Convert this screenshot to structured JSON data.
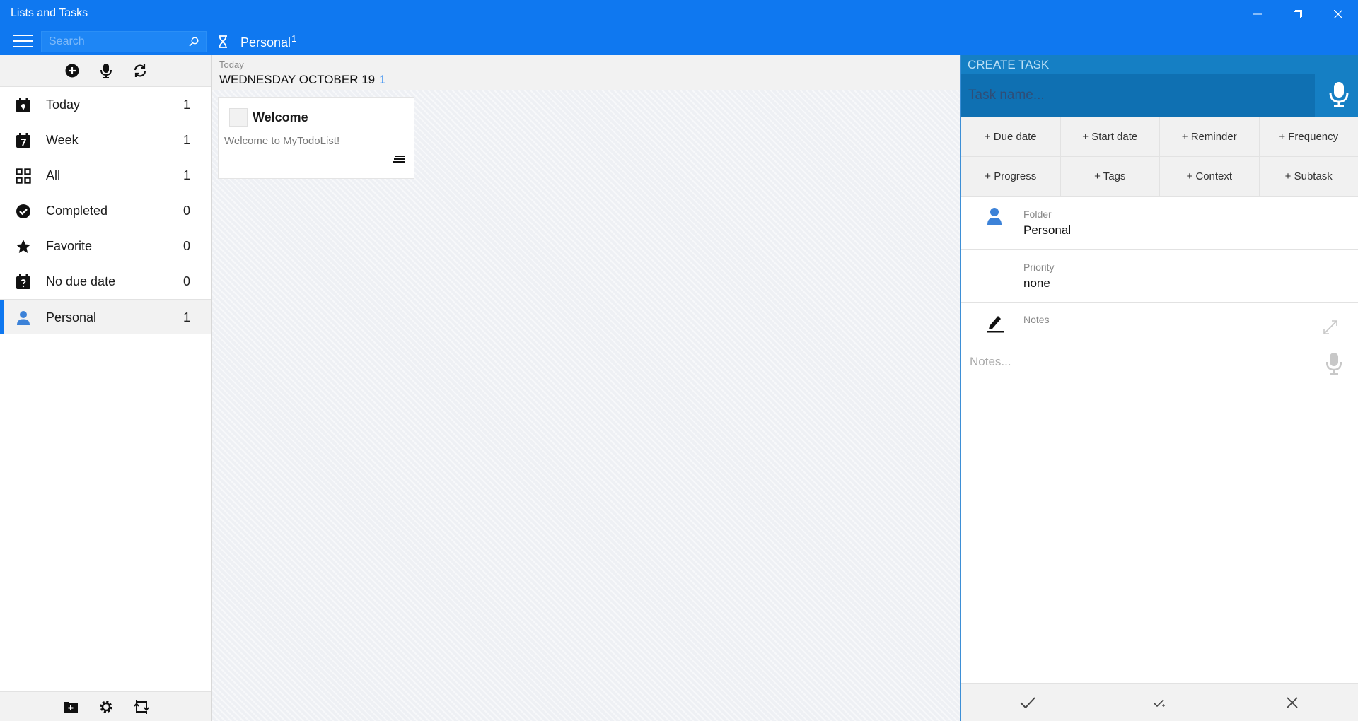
{
  "window": {
    "title": "Lists and Tasks"
  },
  "appbar": {
    "search_placeholder": "Search",
    "crumb_label": "Personal",
    "crumb_count": "1"
  },
  "sidebar": {
    "items": [
      {
        "label": "Today",
        "count": "1",
        "icon": "calendar-pin-icon"
      },
      {
        "label": "Week",
        "count": "1",
        "icon": "calendar-week-icon"
      },
      {
        "label": "All",
        "count": "1",
        "icon": "grid-icon"
      },
      {
        "label": "Completed",
        "count": "0",
        "icon": "check-circle-icon"
      },
      {
        "label": "Favorite",
        "count": "0",
        "icon": "star-icon"
      },
      {
        "label": "No due date",
        "count": "0",
        "icon": "calendar-question-icon"
      },
      {
        "label": "Personal",
        "count": "1",
        "icon": "person-icon"
      }
    ]
  },
  "main": {
    "date_sub": "Today",
    "date_main": "WEDNESDAY OCTOBER 19",
    "date_count": "1",
    "task": {
      "title": "Welcome",
      "description": "Welcome to MyTodoList!"
    }
  },
  "panel": {
    "title": "CREATE TASK",
    "taskname_placeholder": "Task name...",
    "chips_row1": [
      "+ Due date",
      "+ Start date",
      "+ Reminder",
      "+ Frequency"
    ],
    "chips_row2": [
      "+ Progress",
      "+ Tags",
      "+ Context",
      "+ Subtask"
    ],
    "folder_label": "Folder",
    "folder_value": "Personal",
    "priority_label": "Priority",
    "priority_value": "none",
    "notes_label": "Notes",
    "notes_placeholder": "Notes..."
  },
  "colors": {
    "accent": "#0f78f0",
    "panel_header": "#157fc4",
    "person_icon": "#3c82d8"
  }
}
